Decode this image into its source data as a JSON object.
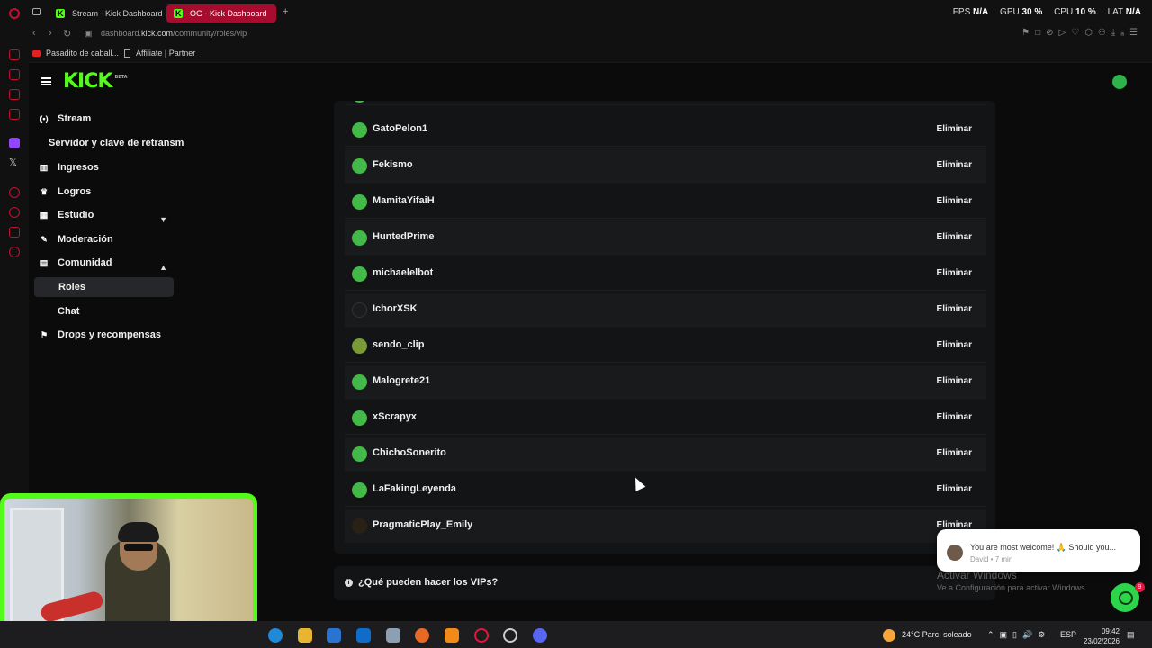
{
  "browser": {
    "tabs": [
      {
        "label": "Stream - Kick Dashboard"
      },
      {
        "label": "OG - Kick Dashboard"
      }
    ],
    "stats": {
      "fps_label": "FPS",
      "fps_value": "N/A",
      "gpu_label": "GPU",
      "gpu_value": "30 %",
      "cpu_label": "CPU",
      "cpu_value": "10 %",
      "lat_label": "LAT",
      "lat_value": "N/A"
    },
    "url_prefix": "dashboard.",
    "url_domain": "kick.com",
    "url_path": "/community/roles/vip",
    "bookmarks": [
      {
        "label": "Pasadito de caball..."
      },
      {
        "label": "Affiliate | Partner"
      }
    ]
  },
  "sidebar": {
    "items": [
      {
        "label": "Stream"
      },
      {
        "label": "Servidor y clave de retransm"
      },
      {
        "label": "Ingresos"
      },
      {
        "label": "Logros"
      },
      {
        "label": "Estudio"
      },
      {
        "label": "Moderación"
      },
      {
        "label": "Comunidad"
      },
      {
        "label": "Roles"
      },
      {
        "label": "Chat"
      },
      {
        "label": "Drops y recompensas"
      }
    ]
  },
  "vip_list": {
    "remove_label": "Eliminar",
    "users": [
      {
        "name": "GatoPelon1"
      },
      {
        "name": "Fekismo"
      },
      {
        "name": "MamitaYifaiH"
      },
      {
        "name": "HuntedPrime"
      },
      {
        "name": "michaelelbot"
      },
      {
        "name": "IchorXSK"
      },
      {
        "name": "sendo_clip"
      },
      {
        "name": "Malogrete21"
      },
      {
        "name": "xScrapyx"
      },
      {
        "name": "ChichoSonerito"
      },
      {
        "name": "LaFakingLeyenda"
      },
      {
        "name": "PragmaticPlay_Emily"
      }
    ]
  },
  "info": {
    "question": "¿Qué pueden hacer los VIPs?"
  },
  "notification": {
    "message": "You are most welcome! 🙏 Should you...",
    "meta": "David • 7 min",
    "badge": "9"
  },
  "windows": {
    "activate_title": "Activar Windows",
    "activate_sub": "Ve a Configuración para activar Windows.",
    "weather": "24°C  Parc. soleado",
    "lang": "ESP",
    "time": "09:42",
    "date": "23/02/2026"
  },
  "colors": {
    "accent": "#53fc18",
    "tab_active": "#a60c2e"
  }
}
